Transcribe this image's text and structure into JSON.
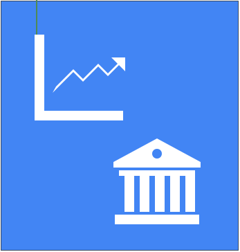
{
  "colors": {
    "tile_blue": "#4285f4",
    "icon_white": "#ffffff",
    "pin_green": "#4f8a55",
    "border_dark": "#3b4a5e"
  },
  "icons": {
    "chart": "trending-up-chart-icon",
    "bank": "bank-building-icon"
  }
}
